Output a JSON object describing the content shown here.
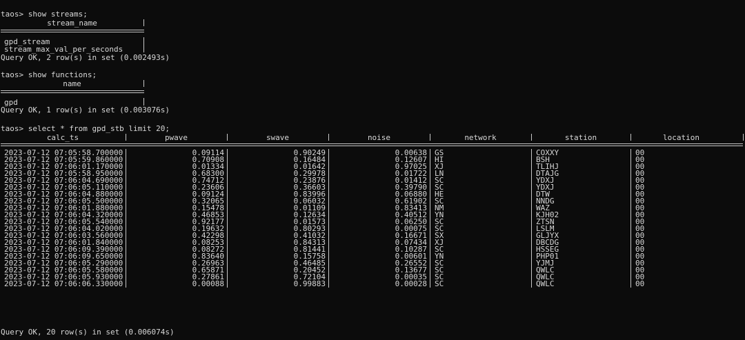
{
  "terminal": {
    "prompt": "taos>",
    "block1": {
      "command": "taos> show streams;",
      "header": "stream_name",
      "rows": [
        "gpd_stream",
        "stream_max_val_per_seconds"
      ],
      "status": "Query OK, 2 row(s) in set (0.002493s)"
    },
    "block2": {
      "command": "taos> show functions;",
      "header": "name",
      "rows": [
        "gpd"
      ],
      "status": "Query OK, 1 row(s) in set (0.003076s)"
    },
    "block3": {
      "command": "taos> select * from gpd_stb limit 20;",
      "status": "Query OK, 20 row(s) in set (0.006074s)"
    }
  },
  "table": {
    "columns": [
      "calc_ts",
      "pwave",
      "swave",
      "noise",
      "network",
      "station",
      "location"
    ],
    "rows": [
      [
        "2023-07-12 07:05:58.700000",
        "0.09114",
        "0.90249",
        "0.00638",
        "GS",
        "COXXY",
        "00"
      ],
      [
        "2023-07-12 07:05:59.860000",
        "0.70908",
        "0.16484",
        "0.12607",
        "HI",
        "BSH",
        "00"
      ],
      [
        "2023-07-12 07:06:01.170000",
        "0.01334",
        "0.01642",
        "0.97025",
        "XJ",
        "TLIHJ",
        "00"
      ],
      [
        "2023-07-12 07:05:58.950000",
        "0.68300",
        "0.29978",
        "0.01722",
        "LN",
        "DTAJG",
        "00"
      ],
      [
        "2023-07-12 07:06:04.690000",
        "0.74712",
        "0.23876",
        "0.01412",
        "SC",
        "YDXJ",
        "00"
      ],
      [
        "2023-07-12 07:06:05.110000",
        "0.23606",
        "0.36603",
        "0.39790",
        "SC",
        "YDXJ",
        "00"
      ],
      [
        "2023-07-12 07:06:04.880000",
        "0.09124",
        "0.83996",
        "0.06880",
        "HE",
        "DTW",
        "00"
      ],
      [
        "2023-07-12 07:06:05.500000",
        "0.32065",
        "0.06032",
        "0.61902",
        "SC",
        "NNDG",
        "00"
      ],
      [
        "2023-07-12 07:06:01.880000",
        "0.15478",
        "0.01109",
        "0.83413",
        "NM",
        "WAZ",
        "00"
      ],
      [
        "2023-07-12 07:06:04.320000",
        "0.46853",
        "0.12634",
        "0.40512",
        "YN",
        "KJH02",
        "00"
      ],
      [
        "2023-07-12 07:06:05.540000",
        "0.92177",
        "0.01573",
        "0.06250",
        "SC",
        "ZTSN",
        "00"
      ],
      [
        "2023-07-12 07:06:04.020000",
        "0.19632",
        "0.80293",
        "0.00075",
        "SC",
        "LSLM",
        "00"
      ],
      [
        "2023-07-12 07:06:03.560000",
        "0.42298",
        "0.41032",
        "0.16671",
        "SX",
        "GLJYX",
        "00"
      ],
      [
        "2023-07-12 07:06:01.840000",
        "0.08253",
        "0.84313",
        "0.07434",
        "XJ",
        "DBCDG",
        "00"
      ],
      [
        "2023-07-12 07:06:09.390000",
        "0.08272",
        "0.81441",
        "0.10287",
        "SC",
        "HSSEG",
        "00"
      ],
      [
        "2023-07-12 07:06:09.650000",
        "0.83640",
        "0.15758",
        "0.00601",
        "YN",
        "PHP01",
        "00"
      ],
      [
        "2023-07-12 07:06:05.290000",
        "0.26963",
        "0.46485",
        "0.26552",
        "SC",
        "YJMJ",
        "00"
      ],
      [
        "2023-07-12 07:06:05.580000",
        "0.65871",
        "0.20452",
        "0.13677",
        "SC",
        "QWLC",
        "00"
      ],
      [
        "2023-07-12 07:06:05.930000",
        "0.27861",
        "0.72104",
        "0.00035",
        "SC",
        "QWLC",
        "00"
      ],
      [
        "2023-07-12 07:06:06.330000",
        "0.00088",
        "0.99883",
        "0.00028",
        "SC",
        "QWLC",
        "00"
      ]
    ]
  },
  "colors": {
    "background": "#0c0c0c",
    "text": "#d8d8d8"
  }
}
